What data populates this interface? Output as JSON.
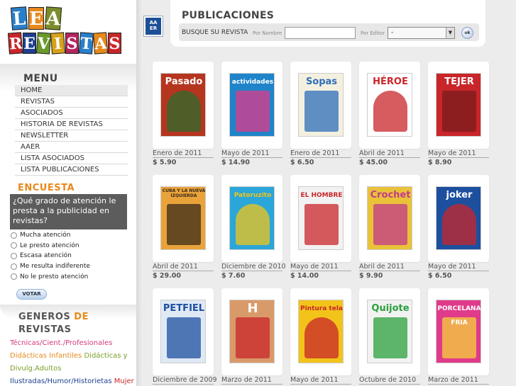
{
  "logo": {
    "row1": [
      {
        "ch": "L",
        "bg": "#2a7fc9"
      },
      {
        "ch": "E",
        "bg": "#e8891b"
      },
      {
        "ch": "A",
        "bg": "#7b8e2a"
      }
    ],
    "row2": [
      {
        "ch": "R",
        "bg": "#c8262a"
      },
      {
        "ch": "E",
        "bg": "#1d3f8f"
      },
      {
        "ch": "V",
        "bg": "#6a9a2a"
      },
      {
        "ch": "I",
        "bg": "#d7a21a"
      },
      {
        "ch": "S",
        "bg": "#b3255f"
      },
      {
        "ch": "T",
        "bg": "#2a7fc9"
      },
      {
        "ch": "A",
        "bg": "#e8891b"
      },
      {
        "ch": "S",
        "bg": "#c8262a"
      }
    ]
  },
  "menu": {
    "title": "MENU",
    "items": [
      "HOME",
      "REVISTAS",
      "ASOCIADOS",
      "HISTORIA DE REVISTAS",
      "NEWSLETTER",
      "AAER",
      "LISTA ASOCIADOS",
      "LISTA PUBLICACIONES"
    ]
  },
  "poll": {
    "title": "ENCUESTA",
    "question": "¿Qué grado de atención le presta a la publicidad en revistas?",
    "options": [
      "Mucha atención",
      "Le presto atención",
      "Escasa atención",
      "Me resulta indiferente",
      "No le presto atención"
    ],
    "vote_label": "VOTAR"
  },
  "genres": {
    "title_a": "GENEROS",
    "title_b": "DE",
    "title_c": "REVISTAS",
    "items": [
      {
        "label": "Técnicas/Cient./Profesionales",
        "color": "#d63a7a"
      },
      {
        "label": "Didácticas Infantiles",
        "color": "#e8891b"
      },
      {
        "label": "Didácticas y Divulg.Adultos",
        "color": "#7aa02a"
      },
      {
        "label": "Ilustradas/Humor/Historietas",
        "color": "#1d3f8f"
      },
      {
        "label": "Mujer y",
        "color": "#c8262a"
      }
    ]
  },
  "header": {
    "aaer_logo": "AA ER",
    "title": "PUBLICACIONES",
    "search_label": "BUSQUE SU REVISTA",
    "by_name": "Por Nombre",
    "name_value": "",
    "by_editor": "Por Editor",
    "editor_selected": "-",
    "ok_label": "ok"
  },
  "magazines": [
    {
      "masthead": "Pasado",
      "date": "Enero de 2011",
      "price": "$ 5.90",
      "color": "#b5351e",
      "accent": "#2d6b2d"
    },
    {
      "masthead": "actividades",
      "date": "Mayo de 2011",
      "price": "$ 14.90",
      "color": "#1f84c9",
      "accent": "#e03a8a"
    },
    {
      "masthead": "Sopas",
      "date": "Enero de 2011",
      "price": "$ 6.50",
      "color": "#f4f0e0",
      "accent": "#2d6fb8"
    },
    {
      "masthead": "HÉROE",
      "date": "Abril de 2011",
      "price": "$ 45.00",
      "color": "#ffffff",
      "accent": "#c8262a"
    },
    {
      "masthead": "TEJER",
      "date": "Mayo de 2011",
      "price": "$ 8.90",
      "color": "#c8262a",
      "accent": "#7a1c1c"
    },
    {
      "masthead": "CUBA Y LA NUEVA IZQUIERDA",
      "date": "Abril de 2011",
      "price": "$ 29.00",
      "color": "#e9a33a",
      "accent": "#3a2a1a"
    },
    {
      "masthead": "Patoruzito",
      "date": "Diciembre de 2010",
      "price": "$ 7.60",
      "color": "#2aa6d9",
      "accent": "#f2c41a"
    },
    {
      "masthead": "EL HOMBRE",
      "date": "Mayo de 2011",
      "price": "$ 14.00",
      "color": "#f2f2f2",
      "accent": "#c8262a"
    },
    {
      "masthead": "Crochet",
      "date": "Abril de 2011",
      "price": "$ 9.90",
      "color": "#e9c23a",
      "accent": "#c23a8a"
    },
    {
      "masthead": "joker",
      "date": "Mayo de 2011",
      "price": "$ 6.50",
      "color": "#1d4f9f",
      "accent": "#c8262a"
    },
    {
      "masthead": "PETFIEL",
      "date": "Diciembre de 2009",
      "price": "",
      "color": "#dfe9f5",
      "accent": "#1d4f9f"
    },
    {
      "masthead": "H",
      "date": "Marzo de 2011",
      "price": "",
      "color": "#d99a6a",
      "accent": "#c8262a"
    },
    {
      "masthead": "Pintura tela",
      "date": "Mayo de 2011",
      "price": "",
      "color": "#f2c41a",
      "accent": "#c8262a"
    },
    {
      "masthead": "Quijote",
      "date": "Octubre de 2010",
      "price": "",
      "color": "#f2f2f2",
      "accent": "#2aa03a"
    },
    {
      "masthead": "PORCELANA FRIA",
      "date": "Marzo de 2011",
      "price": "",
      "color": "#e03a8a",
      "accent": "#f4d23a"
    }
  ]
}
